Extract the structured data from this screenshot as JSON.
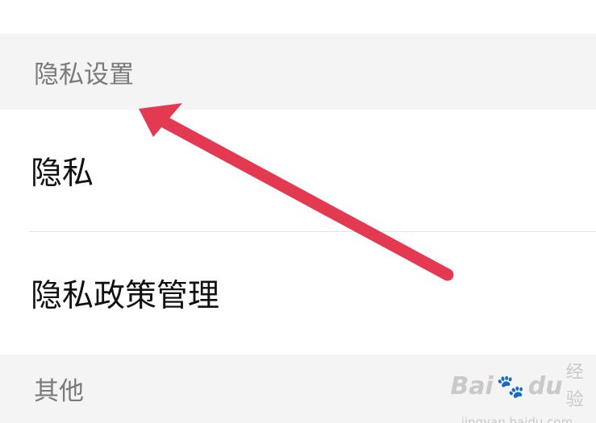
{
  "sections": [
    {
      "header": "隐私设置"
    },
    {
      "header": "其他"
    }
  ],
  "items": [
    {
      "label": "隐私"
    },
    {
      "label": "隐私政策管理"
    }
  ],
  "annotation": {
    "arrow_color": "#e33a52"
  },
  "watermark": {
    "logo_text": "Bai",
    "logo_text_2": "du",
    "logo_cn": "经验",
    "url": "jingyan.baidu.com"
  }
}
